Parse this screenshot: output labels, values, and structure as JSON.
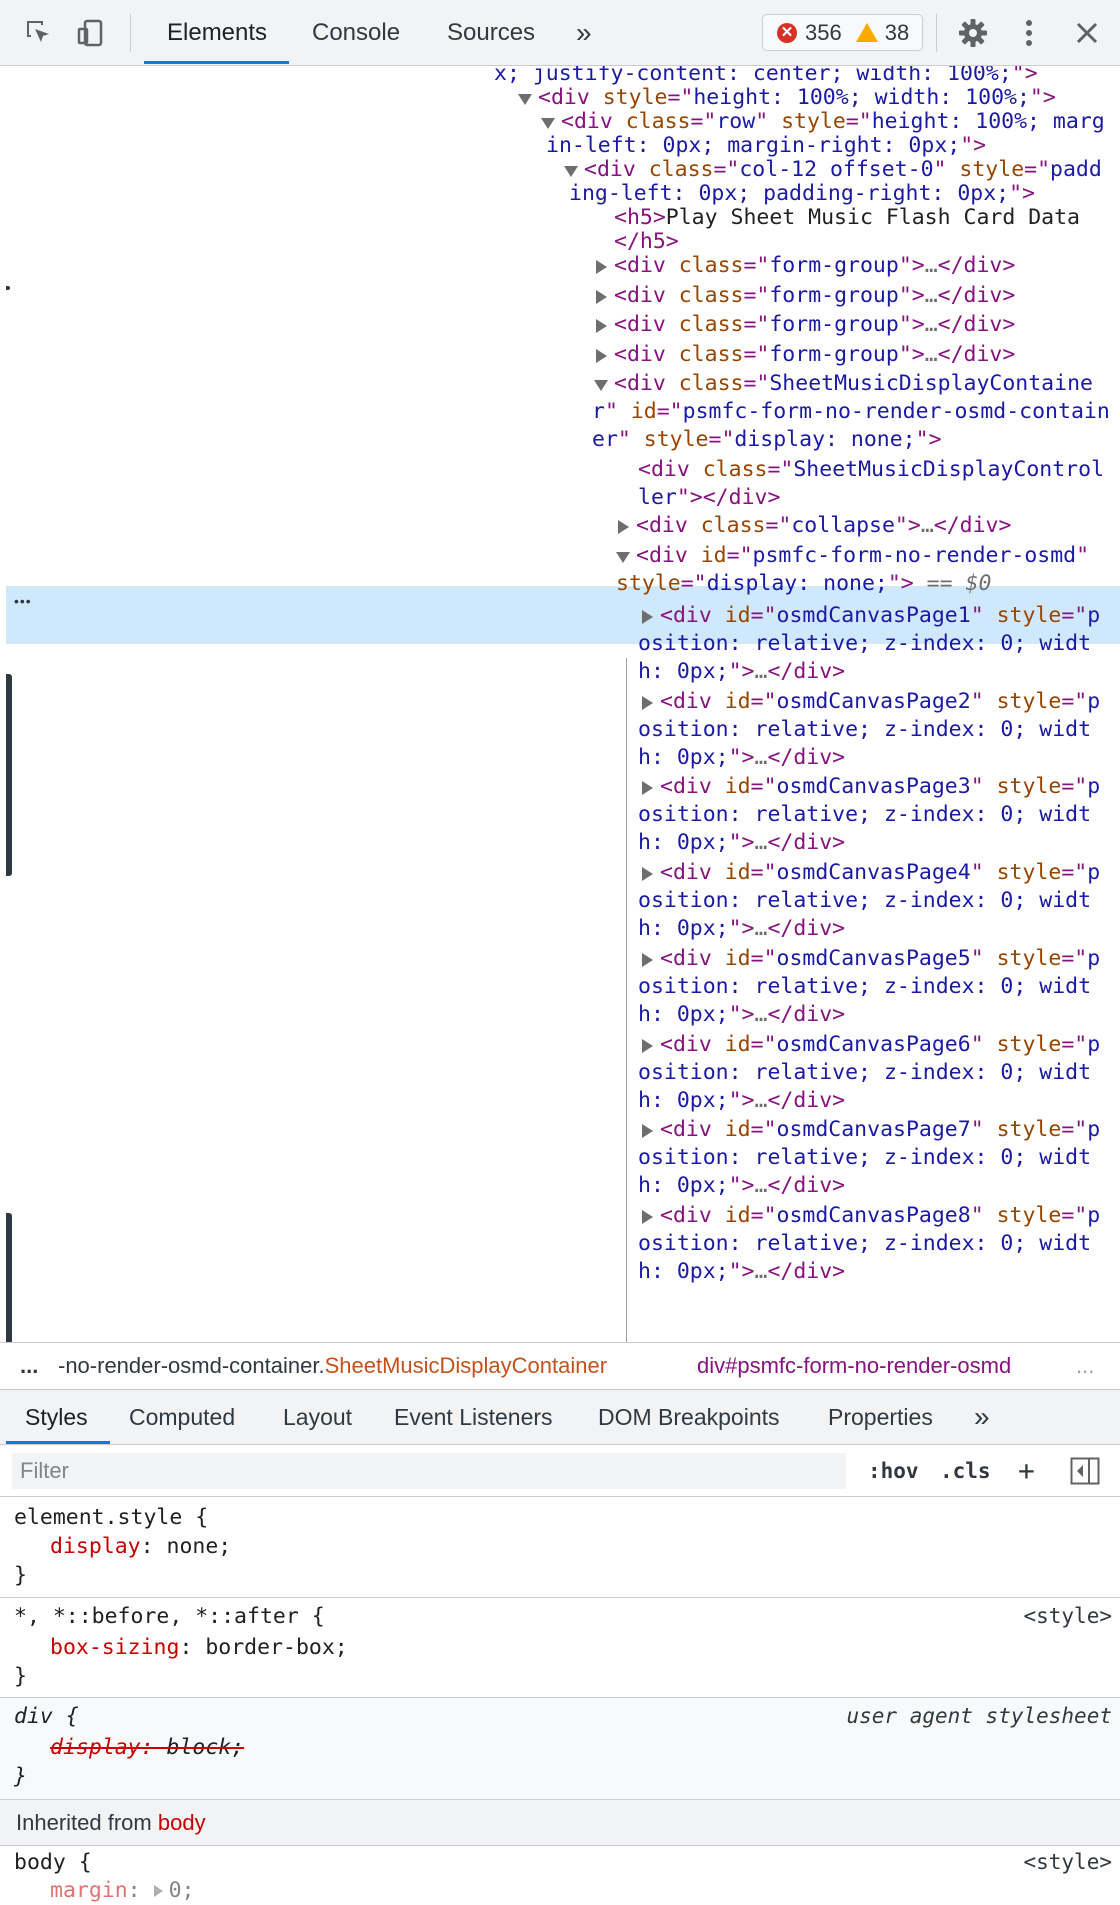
{
  "toolbar": {
    "tabs": [
      "Elements",
      "Console",
      "Sources"
    ],
    "more_tabs_label": "»",
    "error_count": "356",
    "warning_count": "38",
    "icons": [
      "inspect-icon",
      "device-toggle-icon",
      "settings-gear-icon",
      "kebab-menu-icon",
      "close-icon"
    ]
  },
  "tree": {
    "lines": [
      {
        "parts": [
          [
            "v",
            "x; justify-content: center; width: 100%;"
          ],
          [
            "t",
            "\">"
          ]
        ]
      },
      {
        "parts": [
          [
            "t",
            "<div "
          ],
          [
            "a",
            "style"
          ],
          [
            "t",
            "=\""
          ],
          [
            "v",
            "height: 100%; width: 100%;"
          ],
          [
            "t",
            "\">"
          ]
        ]
      },
      {
        "parts": [
          [
            "t",
            "<div "
          ],
          [
            "a",
            "class"
          ],
          [
            "t",
            "=\""
          ],
          [
            "v",
            "row"
          ],
          [
            "t",
            "\" "
          ],
          [
            "a",
            "style"
          ],
          [
            "t",
            "=\""
          ],
          [
            "v",
            "height: 100%; marg"
          ]
        ]
      },
      {
        "parts": [
          [
            "v",
            "in-left: 0px; margin-right: 0px;"
          ],
          [
            "t",
            "\">"
          ]
        ]
      },
      {
        "parts": [
          [
            "t",
            "<div "
          ],
          [
            "a",
            "class"
          ],
          [
            "t",
            "=\""
          ],
          [
            "v",
            "col-12 offset-0"
          ],
          [
            "t",
            "\" "
          ],
          [
            "a",
            "style"
          ],
          [
            "t",
            "=\""
          ],
          [
            "v",
            "padd"
          ]
        ]
      },
      {
        "parts": [
          [
            "v",
            "ing-left: 0px; padding-right: 0px;"
          ],
          [
            "t",
            "\">"
          ]
        ]
      },
      {
        "parts": [
          [
            "t",
            "<h5>"
          ],
          [
            "x",
            "Play Sheet Music Flash Card Data"
          ]
        ]
      },
      {
        "parts": [
          [
            "t",
            "</h5>"
          ]
        ]
      },
      {
        "parts": [
          [
            "t",
            "<div "
          ],
          [
            "a",
            "class"
          ],
          [
            "t",
            "=\""
          ],
          [
            "v",
            "form-group"
          ],
          [
            "t",
            "\">"
          ],
          [
            "d",
            "…"
          ],
          [
            "t",
            "</div>"
          ]
        ]
      },
      {
        "parts": [
          [
            "t",
            "<div "
          ],
          [
            "a",
            "class"
          ],
          [
            "t",
            "=\""
          ],
          [
            "v",
            "form-group"
          ],
          [
            "t",
            "\">"
          ],
          [
            "d",
            "…"
          ],
          [
            "t",
            "</div>"
          ]
        ]
      },
      {
        "parts": [
          [
            "t",
            "<div "
          ],
          [
            "a",
            "class"
          ],
          [
            "t",
            "=\""
          ],
          [
            "v",
            "form-group"
          ],
          [
            "t",
            "\">"
          ],
          [
            "d",
            "…"
          ],
          [
            "t",
            "</div>"
          ]
        ]
      },
      {
        "parts": [
          [
            "t",
            "<div "
          ],
          [
            "a",
            "class"
          ],
          [
            "t",
            "=\""
          ],
          [
            "v",
            "form-group"
          ],
          [
            "t",
            "\">"
          ],
          [
            "d",
            "…"
          ],
          [
            "t",
            "</div>"
          ]
        ]
      },
      {
        "parts": [
          [
            "t",
            "<div "
          ],
          [
            "a",
            "class"
          ],
          [
            "t",
            "=\""
          ],
          [
            "v",
            "SheetMusicDisplayContaine"
          ]
        ]
      },
      {
        "parts": [
          [
            "v",
            "r"
          ],
          [
            "t",
            "\" "
          ],
          [
            "a",
            "id"
          ],
          [
            "t",
            "=\""
          ],
          [
            "v",
            "psmfc-form-no-render-osmd-contain"
          ]
        ]
      },
      {
        "parts": [
          [
            "v",
            "er"
          ],
          [
            "t",
            "\" "
          ],
          [
            "a",
            "style"
          ],
          [
            "t",
            "=\""
          ],
          [
            "v",
            "display: none;"
          ],
          [
            "t",
            "\">"
          ]
        ]
      },
      {
        "parts": [
          [
            "t",
            "<div "
          ],
          [
            "a",
            "class"
          ],
          [
            "t",
            "=\""
          ],
          [
            "v",
            "SheetMusicDisplayControl"
          ]
        ]
      },
      {
        "parts": [
          [
            "v",
            "ler"
          ],
          [
            "t",
            "\"></div>"
          ]
        ]
      },
      {
        "parts": [
          [
            "t",
            "<div "
          ],
          [
            "a",
            "class"
          ],
          [
            "t",
            "=\""
          ],
          [
            "v",
            "collapse"
          ],
          [
            "t",
            "\">"
          ],
          [
            "d",
            "…"
          ],
          [
            "t",
            "</div>"
          ]
        ]
      },
      {
        "parts": [
          [
            "t",
            "<div "
          ],
          [
            "a",
            "id"
          ],
          [
            "t",
            "=\""
          ],
          [
            "v",
            "psmfc-form-no-render-osmd"
          ],
          [
            "t",
            "\""
          ]
        ]
      },
      {
        "parts": [
          [
            "a",
            "style"
          ],
          [
            "t",
            "=\""
          ],
          [
            "v",
            "display: none;"
          ],
          [
            "t",
            "\">"
          ],
          [
            "d",
            " == "
          ],
          [
            "s",
            "$0"
          ]
        ]
      },
      {
        "parts": [
          [
            "t",
            "<div "
          ],
          [
            "a",
            "id"
          ],
          [
            "t",
            "=\""
          ],
          [
            "v",
            "osmdCanvasPage1"
          ],
          [
            "t",
            "\" "
          ],
          [
            "a",
            "style"
          ],
          [
            "t",
            "=\""
          ],
          [
            "v",
            "p"
          ]
        ]
      },
      {
        "parts": [
          [
            "v",
            "osition: relative; z-index: 0; widt"
          ]
        ]
      },
      {
        "parts": [
          [
            "v",
            "h: 0px;"
          ],
          [
            "t",
            "\">"
          ],
          [
            "d",
            "…"
          ],
          [
            "t",
            "</div>"
          ]
        ]
      },
      {
        "parts": [
          [
            "t",
            "<div "
          ],
          [
            "a",
            "id"
          ],
          [
            "t",
            "=\""
          ],
          [
            "v",
            "osmdCanvasPage2"
          ],
          [
            "t",
            "\" "
          ],
          [
            "a",
            "style"
          ],
          [
            "t",
            "=\""
          ],
          [
            "v",
            "p"
          ]
        ]
      },
      {
        "parts": [
          [
            "v",
            "osition: relative; z-index: 0; widt"
          ]
        ]
      },
      {
        "parts": [
          [
            "v",
            "h: 0px;"
          ],
          [
            "t",
            "\">"
          ],
          [
            "d",
            "…"
          ],
          [
            "t",
            "</div>"
          ]
        ]
      },
      {
        "parts": [
          [
            "t",
            "<div "
          ],
          [
            "a",
            "id"
          ],
          [
            "t",
            "=\""
          ],
          [
            "v",
            "osmdCanvasPage3"
          ],
          [
            "t",
            "\" "
          ],
          [
            "a",
            "style"
          ],
          [
            "t",
            "=\""
          ],
          [
            "v",
            "p"
          ]
        ]
      },
      {
        "parts": [
          [
            "v",
            "osition: relative; z-index: 0; widt"
          ]
        ]
      },
      {
        "parts": [
          [
            "v",
            "h: 0px;"
          ],
          [
            "t",
            "\">"
          ],
          [
            "d",
            "…"
          ],
          [
            "t",
            "</div>"
          ]
        ]
      },
      {
        "parts": [
          [
            "t",
            "<div "
          ],
          [
            "a",
            "id"
          ],
          [
            "t",
            "=\""
          ],
          [
            "v",
            "osmdCanvasPage4"
          ],
          [
            "t",
            "\" "
          ],
          [
            "a",
            "style"
          ],
          [
            "t",
            "=\""
          ],
          [
            "v",
            "p"
          ]
        ]
      },
      {
        "parts": [
          [
            "v",
            "osition: relative; z-index: 0; widt"
          ]
        ]
      },
      {
        "parts": [
          [
            "v",
            "h: 0px;"
          ],
          [
            "t",
            "\">"
          ],
          [
            "d",
            "…"
          ],
          [
            "t",
            "</div>"
          ]
        ]
      },
      {
        "parts": [
          [
            "t",
            "<div "
          ],
          [
            "a",
            "id"
          ],
          [
            "t",
            "=\""
          ],
          [
            "v",
            "osmdCanvasPage5"
          ],
          [
            "t",
            "\" "
          ],
          [
            "a",
            "style"
          ],
          [
            "t",
            "=\""
          ],
          [
            "v",
            "p"
          ]
        ]
      },
      {
        "parts": [
          [
            "v",
            "osition: relative; z-index: 0; widt"
          ]
        ]
      },
      {
        "parts": [
          [
            "v",
            "h: 0px;"
          ],
          [
            "t",
            "\">"
          ],
          [
            "d",
            "…"
          ],
          [
            "t",
            "</div>"
          ]
        ]
      },
      {
        "parts": [
          [
            "t",
            "<div "
          ],
          [
            "a",
            "id"
          ],
          [
            "t",
            "=\""
          ],
          [
            "v",
            "osmdCanvasPage6"
          ],
          [
            "t",
            "\" "
          ],
          [
            "a",
            "style"
          ],
          [
            "t",
            "=\""
          ],
          [
            "v",
            "p"
          ]
        ]
      },
      {
        "parts": [
          [
            "v",
            "osition: relative; z-index: 0; widt"
          ]
        ]
      },
      {
        "parts": [
          [
            "v",
            "h: 0px;"
          ],
          [
            "t",
            "\">"
          ],
          [
            "d",
            "…"
          ],
          [
            "t",
            "</div>"
          ]
        ]
      },
      {
        "parts": [
          [
            "t",
            "<div "
          ],
          [
            "a",
            "id"
          ],
          [
            "t",
            "=\""
          ],
          [
            "v",
            "osmdCanvasPage7"
          ],
          [
            "t",
            "\" "
          ],
          [
            "a",
            "style"
          ],
          [
            "t",
            "=\""
          ],
          [
            "v",
            "p"
          ]
        ]
      },
      {
        "parts": [
          [
            "v",
            "osition: relative; z-index: 0; widt"
          ]
        ]
      },
      {
        "parts": [
          [
            "v",
            "h: 0px;"
          ],
          [
            "t",
            "\">"
          ],
          [
            "d",
            "…"
          ],
          [
            "t",
            "</div>"
          ]
        ]
      },
      {
        "parts": [
          [
            "t",
            "<div "
          ],
          [
            "a",
            "id"
          ],
          [
            "t",
            "=\""
          ],
          [
            "v",
            "osmdCanvasPage8"
          ],
          [
            "t",
            "\" "
          ],
          [
            "a",
            "style"
          ],
          [
            "t",
            "=\""
          ],
          [
            "v",
            "p"
          ]
        ]
      },
      {
        "parts": [
          [
            "v",
            "osition: relative; z-index: 0; widt"
          ]
        ]
      },
      {
        "parts": [
          [
            "v",
            "h: 0px;"
          ],
          [
            "t",
            "\">"
          ],
          [
            "d",
            "…"
          ],
          [
            "t",
            "</div>"
          ]
        ]
      }
    ]
  },
  "breadcrumb": {
    "more_left": "...",
    "item1_tag": "-no-render-osmd-container.",
    "item1_class": "SheetMusicDisplayContainer",
    "item2_tag": "div",
    "item2_id": "#psmfc-form-no-render-osmd",
    "more_right": "..."
  },
  "styles_tabs": [
    "Styles",
    "Computed",
    "Layout",
    "Event Listeners",
    "DOM Breakpoints",
    "Properties",
    "»"
  ],
  "filter": {
    "placeholder": "Filter",
    "hov": ":hov",
    "cls": ".cls",
    "add": "+"
  },
  "rules": {
    "element_style": {
      "selector": "element.style {",
      "prop": "display",
      "val": "none;",
      "close": "}"
    },
    "universal": {
      "selector": "*, *::before, *::after {",
      "source": "<style>",
      "prop": "box-sizing",
      "val": "border-box;",
      "close": "}"
    },
    "div_ua": {
      "selector": "div {",
      "source": "user agent stylesheet",
      "prop": "display",
      "val": "block;",
      "close": "}"
    },
    "inherited_label": "Inherited from",
    "inherited_from": "body",
    "body": {
      "selector": "body {",
      "source": "<style>",
      "prop": "margin",
      "val": "0;"
    }
  }
}
